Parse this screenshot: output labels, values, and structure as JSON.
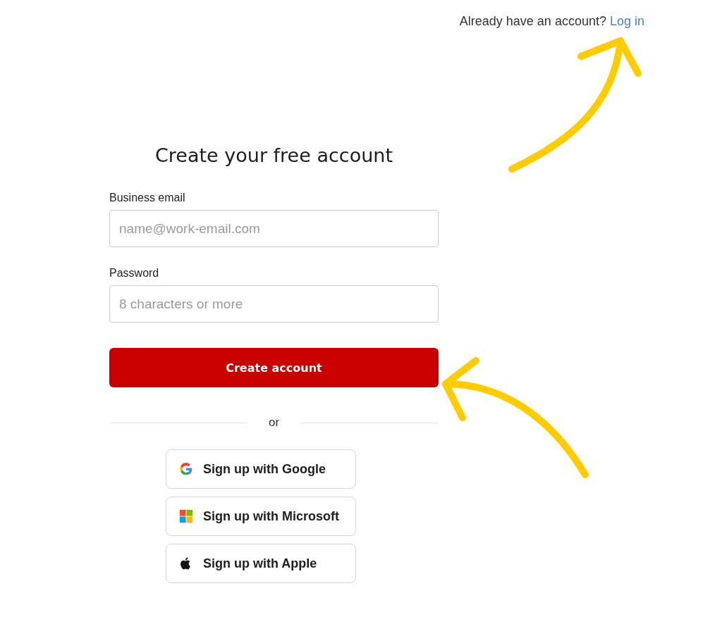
{
  "login_prompt": {
    "text": "Already have an account?",
    "link": "Log in"
  },
  "title": "Create your free account",
  "fields": [
    {
      "label": "Business email",
      "placeholder": "name@work-email.com"
    },
    {
      "label": "Password",
      "placeholder": "8 characters or more"
    }
  ],
  "submit_button": "Create account",
  "divider_text": "or",
  "providers": [
    {
      "kind": "google",
      "label": "Sign up with Google"
    },
    {
      "kind": "microsoft",
      "label": "Sign up with Microsoft"
    },
    {
      "kind": "apple",
      "label": "Sign up with Apple"
    }
  ]
}
